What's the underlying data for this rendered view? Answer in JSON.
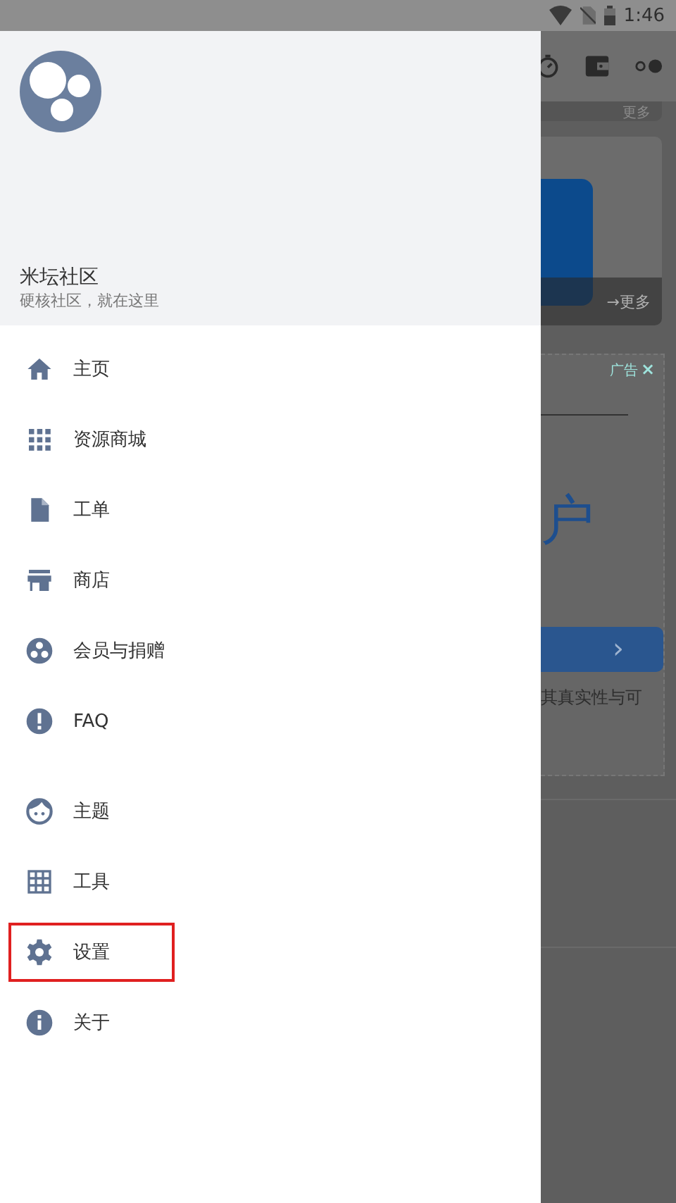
{
  "status_bar": {
    "time": "1:46"
  },
  "drawer": {
    "title": "米坛社区",
    "subtitle": "硬核社区，就在这里",
    "groups": [
      [
        {
          "label": "主页",
          "kind": "home",
          "highlighted": false
        },
        {
          "label": "资源商城",
          "kind": "apps",
          "highlighted": false
        },
        {
          "label": "工单",
          "kind": "file",
          "highlighted": false
        },
        {
          "label": "商店",
          "kind": "store",
          "highlighted": false
        },
        {
          "label": "会员与捐赠",
          "kind": "donate",
          "highlighted": false
        },
        {
          "label": "FAQ",
          "kind": "faq",
          "highlighted": false
        }
      ],
      [
        {
          "label": "主题",
          "kind": "theme",
          "highlighted": false
        },
        {
          "label": "工具",
          "kind": "tools",
          "highlighted": false
        },
        {
          "label": "设置",
          "kind": "settings",
          "highlighted": true
        },
        {
          "label": "关于",
          "kind": "info",
          "highlighted": false
        }
      ]
    ]
  },
  "background": {
    "card_links": [
      "更多",
      "→更多"
    ],
    "ad": {
      "badge": "广告",
      "close": "×",
      "headline": "户",
      "button": "›",
      "caption": "其真实性与可"
    }
  }
}
